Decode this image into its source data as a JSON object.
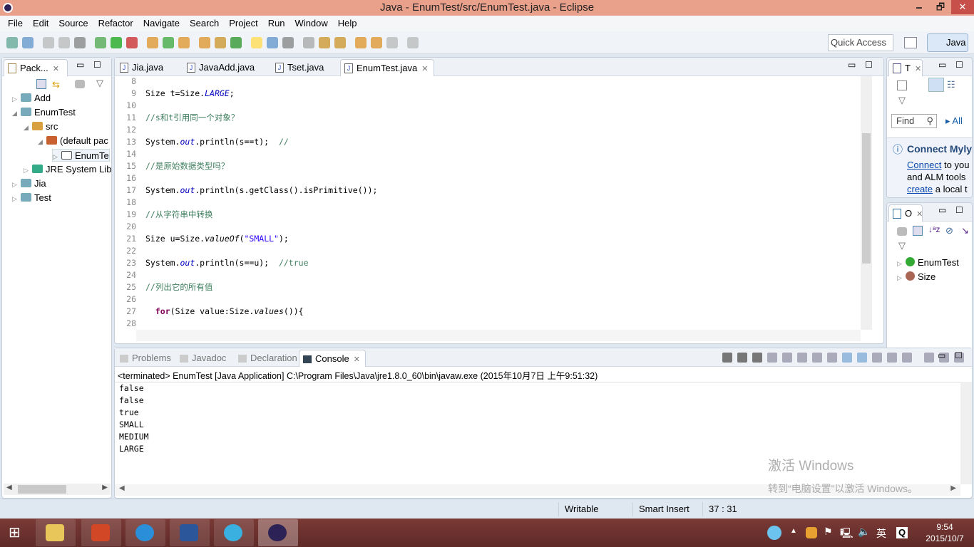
{
  "window": {
    "title": "Java - EnumTest/src/EnumTest.java - Eclipse",
    "minimize": "🗕",
    "restore": "🗗",
    "close": "✕"
  },
  "menu": [
    "File",
    "Edit",
    "Source",
    "Refactor",
    "Navigate",
    "Search",
    "Project",
    "Run",
    "Window",
    "Help"
  ],
  "toolbar": {
    "quick_access": "Quick Access",
    "perspective": "Java"
  },
  "package_explorer": {
    "title": "Pack...",
    "items": [
      {
        "label": "Add",
        "twisty": "▷"
      },
      {
        "label": "EnumTest",
        "twisty": "◢"
      },
      {
        "label": "src",
        "twisty": "◢"
      },
      {
        "label": "(default pac",
        "twisty": "◢"
      },
      {
        "label": "EnumTe",
        "twisty": "▷"
      },
      {
        "label": "JRE System Lib",
        "twisty": "▷"
      },
      {
        "label": "Jia",
        "twisty": "▷"
      },
      {
        "label": "Test",
        "twisty": "▷"
      }
    ]
  },
  "editor": {
    "tabs": [
      "Jia.java",
      "JavaAdd.java",
      "Tset.java",
      "EnumTest.java"
    ],
    "active_tab": "EnumTest.java",
    "lines": [
      {
        "n": "8",
        "html": ""
      },
      {
        "n": "9",
        "html": "Size t=Size.<span class='fld it'>LARGE</span>;"
      },
      {
        "n": "10",
        "html": ""
      },
      {
        "n": "11",
        "html": "<span class='cm'>//s和t引用同一个对象？</span>"
      },
      {
        "n": "12",
        "html": ""
      },
      {
        "n": "13",
        "html": "System.<span class='fld it'>out</span>.println(s==t);  <span class='cm'>//</span>"
      },
      {
        "n": "14",
        "html": ""
      },
      {
        "n": "15",
        "html": "<span class='cm'>//是原始数据类型吗？</span>"
      },
      {
        "n": "16",
        "html": ""
      },
      {
        "n": "17",
        "html": "System.<span class='fld it'>out</span>.println(s.getClass().isPrimitive());"
      },
      {
        "n": "18",
        "html": ""
      },
      {
        "n": "19",
        "html": "<span class='cm'>//从字符串中转换</span>"
      },
      {
        "n": "20",
        "html": ""
      },
      {
        "n": "21",
        "html": "Size u=Size.<span class='it'>valueOf</span>(<span class='str'>\"SMALL\"</span>);"
      },
      {
        "n": "22",
        "html": ""
      },
      {
        "n": "23",
        "html": "System.<span class='fld it'>out</span>.println(s==u);  <span class='cm'>//true</span>"
      },
      {
        "n": "24",
        "html": ""
      },
      {
        "n": "25",
        "html": "<span class='cm'>//列出它的所有值</span>"
      },
      {
        "n": "26",
        "html": ""
      },
      {
        "n": "27",
        "html": "  <span class='kw'>for</span>(Size value:Size.<span class='it'>values</span>()){"
      },
      {
        "n": "28",
        "html": ""
      }
    ]
  },
  "task_list": {
    "title": "T",
    "find_placeholder": "Find",
    "all": "All",
    "mylyn_title": "Connect Myly",
    "mylyn_link1": "Connect",
    "mylyn_text1": " to you",
    "mylyn_text2": "and ALM tools",
    "mylyn_link2": "create",
    "mylyn_text3": " a local t"
  },
  "outline": {
    "title": "O",
    "items": [
      "EnumTest",
      "Size"
    ]
  },
  "bottom": {
    "tabs": [
      "Problems",
      "Javadoc",
      "Declaration",
      "Console"
    ],
    "active_tab": "Console",
    "terminated": "<terminated> EnumTest [Java Application] C:\\Program Files\\Java\\jre1.8.0_60\\bin\\javaw.exe (2015年10月7日 上午9:51:32)",
    "output": [
      "false",
      "false",
      "true",
      "SMALL",
      "MEDIUM",
      "LARGE"
    ]
  },
  "watermark": {
    "line1": "激活 Windows",
    "line2": "转到“电脑设置”以激活 Windows。"
  },
  "status": {
    "writable": "Writable",
    "insert": "Smart Insert",
    "position": "37 : 31"
  },
  "taskbar": {
    "time": "9:54",
    "date": "2015/10/7",
    "ime": "英"
  }
}
